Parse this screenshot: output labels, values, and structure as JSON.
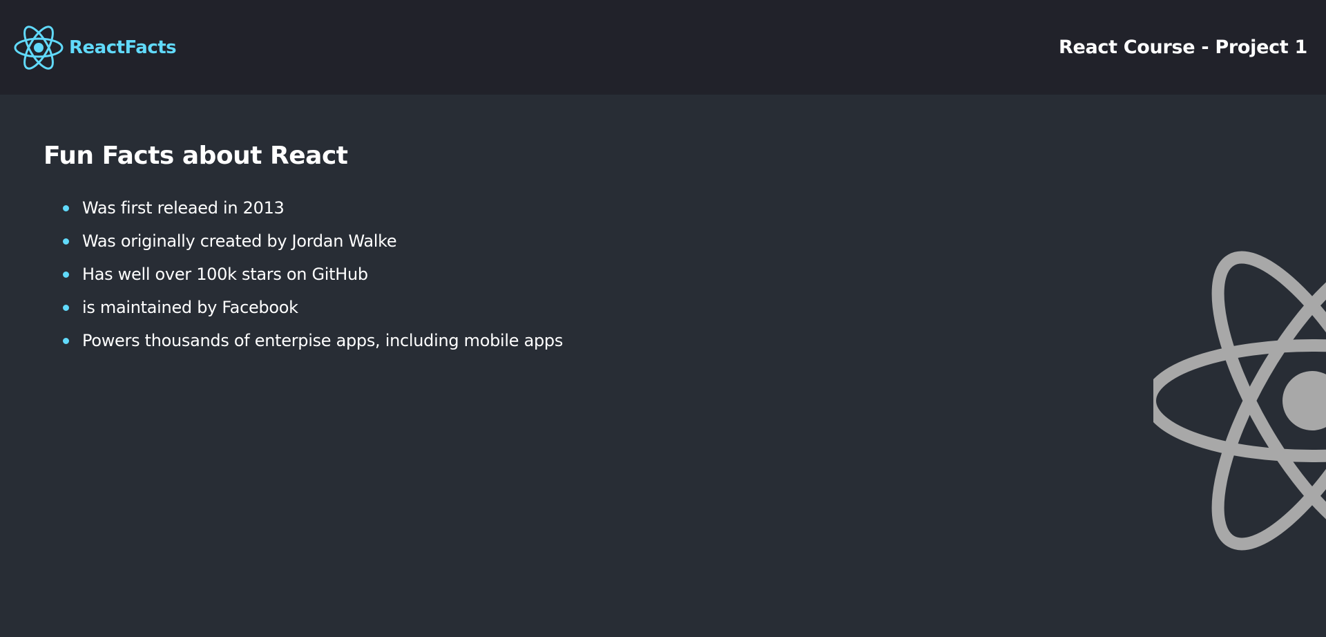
{
  "navbar": {
    "brand_logo_icon": "react-atom-icon",
    "brand_name": "ReactFacts",
    "title": "React Course - Project 1"
  },
  "main": {
    "heading": "Fun Facts about React",
    "facts": [
      "Was first releaed in 2013",
      "Was originally created by Jordan Walke",
      "Has well over 100k stars on GitHub",
      "is maintained by Facebook",
      "Powers thousands of enterpise apps, including mobile apps"
    ],
    "background_icon": "react-atom-icon"
  },
  "colors": {
    "navbar_bg": "#21222a",
    "page_bg": "#282d35",
    "accent": "#61dafb",
    "text": "#ffffff",
    "background_logo": "#a8a8a8"
  }
}
